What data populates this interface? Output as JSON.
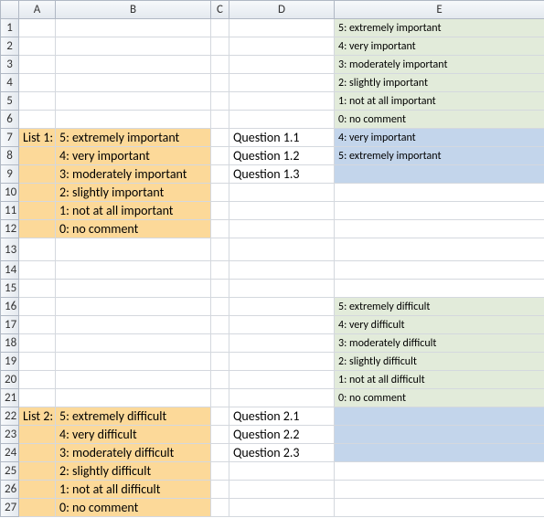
{
  "columns": [
    "A",
    "B",
    "C",
    "D",
    "E"
  ],
  "list1": {
    "label": "List 1:",
    "items": [
      "5: extremely important",
      "4: very important",
      "3: moderately important",
      "2: slightly important",
      "1: not at all important",
      "0: no comment"
    ]
  },
  "list2": {
    "label": "List 2:",
    "items": [
      "5: extremely difficult",
      "4: very difficult",
      "3: moderately difficult",
      "2: slightly difficult",
      "1: not at all difficult",
      "0: no comment"
    ]
  },
  "questions1": [
    "Question 1.1",
    "Question 1.2",
    "Question 1.3"
  ],
  "questions2": [
    "Question 2.1",
    "Question 2.2",
    "Question 2.3"
  ],
  "greenE1": [
    "5: extremely important",
    "4: very important",
    "3: moderately important",
    "2: slightly important",
    "1: not at all important",
    "0: no comment"
  ],
  "blueE1": [
    "4: very important",
    "5: extremely important"
  ],
  "greenE2": [
    "5: extremely difficult",
    "4: very difficult",
    "3: moderately difficult",
    "2: slightly difficult",
    "1: not at all difficult",
    "0: no comment"
  ],
  "rows": [
    "1",
    "2",
    "3",
    "4",
    "5",
    "6",
    "7",
    "8",
    "9",
    "10",
    "11",
    "12",
    "13",
    "14",
    "15",
    "16",
    "17",
    "18",
    "19",
    "20",
    "21",
    "22",
    "23",
    "24",
    "25",
    "26",
    "27"
  ]
}
